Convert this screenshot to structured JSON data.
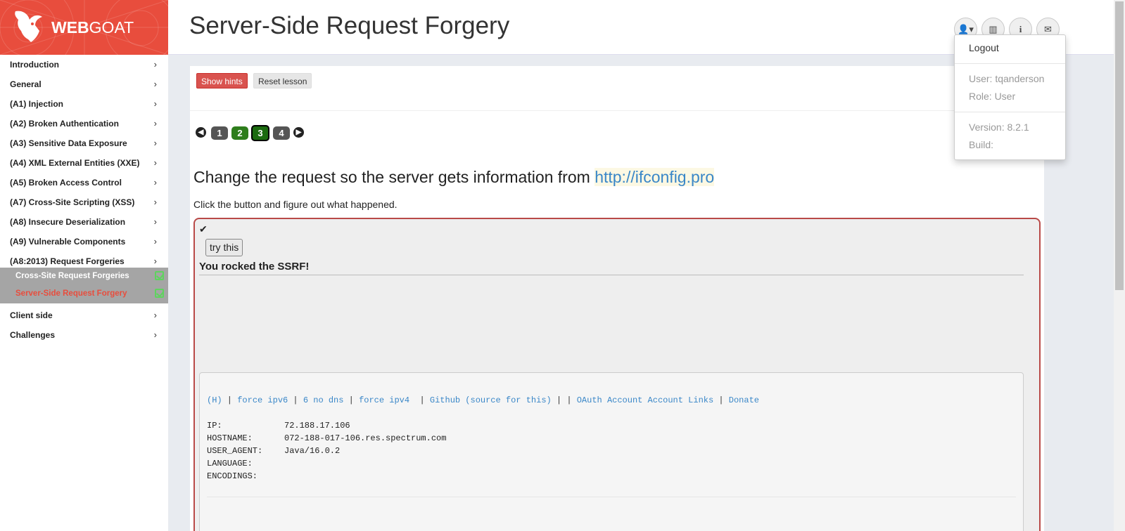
{
  "brand": {
    "bold": "WEB",
    "light": "GOAT"
  },
  "page": {
    "title": "Server-Side Request Forgery"
  },
  "sidebar": {
    "items": [
      {
        "label": "Introduction"
      },
      {
        "label": "General"
      },
      {
        "label": "(A1) Injection"
      },
      {
        "label": "(A2) Broken Authentication"
      },
      {
        "label": "(A3) Sensitive Data Exposure"
      },
      {
        "label": "(A4) XML External Entities (XXE)"
      },
      {
        "label": "(A5) Broken Access Control"
      },
      {
        "label": "(A7) Cross-Site Scripting (XSS)"
      },
      {
        "label": "(A8) Insecure Deserialization"
      },
      {
        "label": "(A9) Vulnerable Components"
      },
      {
        "label": "(A8:2013) Request Forgeries"
      },
      {
        "label": "Client side"
      },
      {
        "label": "Challenges"
      }
    ],
    "subitems": [
      {
        "label": "Cross-Site Request Forgeries",
        "completed": true
      },
      {
        "label": "Server-Side Request Forgery",
        "completed": true,
        "active": true
      }
    ],
    "chevron": "›"
  },
  "header_icons": [
    {
      "name": "user-menu",
      "glyph": "👤▾"
    },
    {
      "name": "report-card",
      "glyph": "▥"
    },
    {
      "name": "about",
      "glyph": "i"
    },
    {
      "name": "contact",
      "glyph": "✉"
    }
  ],
  "user_menu": {
    "logout": "Logout",
    "user": "User: tqanderson",
    "role": "Role: User",
    "version": "Version: 8.2.1",
    "build": "Build:"
  },
  "lesson": {
    "show_hints": "Show hints",
    "reset_lesson": "Reset lesson",
    "pages": [
      "1",
      "2",
      "3",
      "4"
    ],
    "current_page": "3",
    "assignment_title": "Change the request so the server gets information from ",
    "assignment_link": "http://ifconfig.pro",
    "assignment_desc": "Click the button and figure out what happened.",
    "try_button": "try this",
    "result": "You rocked the SSRF!"
  },
  "ifconfig": {
    "links": {
      "h": "(H)",
      "ipv6": "force ipv6",
      "nodns": "6 no dns",
      "ipv4": "force ipv4",
      "github": "Github (source for this)",
      "oauth": "OAuth Account Account Links",
      "donate": "Donate"
    },
    "rows": [
      {
        "key": "IP:",
        "value": "72.188.17.106"
      },
      {
        "key": "HOSTNAME:",
        "value": "072-188-017-106.res.spectrum.com"
      },
      {
        "key": "USER_AGENT:",
        "value": "Java/16.0.2"
      },
      {
        "key": "LANGUAGE:",
        "value": ""
      },
      {
        "key": "ENCODINGS:",
        "value": ""
      }
    ]
  },
  "colors": {
    "brand": "#e84d3d",
    "success": "#2e7d1c",
    "danger": "#d9534f",
    "link": "#3a87c8"
  }
}
